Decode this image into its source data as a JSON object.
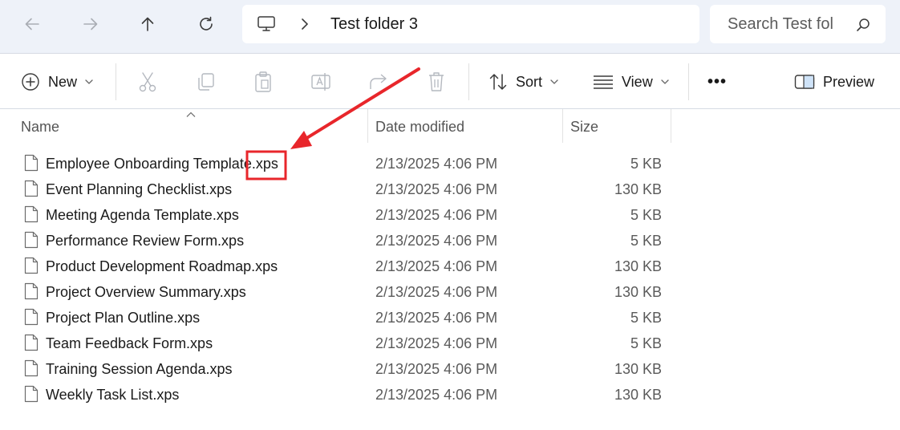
{
  "breadcrumb": {
    "folder": "Test folder 3"
  },
  "search": {
    "placeholder": "Search Test fol"
  },
  "toolbar": {
    "new_label": "New",
    "sort_label": "Sort",
    "view_label": "View",
    "more_label": "•••",
    "preview_label": "Preview"
  },
  "columns": {
    "name": "Name",
    "date_modified": "Date modified",
    "size": "Size"
  },
  "files": [
    {
      "name": "Employee Onboarding Template.xps",
      "date": "2/13/2025 4:06 PM",
      "size": "5 KB"
    },
    {
      "name": "Event Planning Checklist.xps",
      "date": "2/13/2025 4:06 PM",
      "size": "130 KB"
    },
    {
      "name": "Meeting Agenda Template.xps",
      "date": "2/13/2025 4:06 PM",
      "size": "5 KB"
    },
    {
      "name": "Performance Review Form.xps",
      "date": "2/13/2025 4:06 PM",
      "size": "5 KB"
    },
    {
      "name": "Product Development Roadmap.xps",
      "date": "2/13/2025 4:06 PM",
      "size": "130 KB"
    },
    {
      "name": "Project Overview Summary.xps",
      "date": "2/13/2025 4:06 PM",
      "size": "130 KB"
    },
    {
      "name": "Project Plan Outline.xps",
      "date": "2/13/2025 4:06 PM",
      "size": "5 KB"
    },
    {
      "name": "Team Feedback Form.xps",
      "date": "2/13/2025 4:06 PM",
      "size": "5 KB"
    },
    {
      "name": "Training Session Agenda.xps",
      "date": "2/13/2025 4:06 PM",
      "size": "130 KB"
    },
    {
      "name": "Weekly Task List.xps",
      "date": "2/13/2025 4:06 PM",
      "size": "130 KB"
    }
  ],
  "annotation": {
    "color": "#e8262b"
  }
}
